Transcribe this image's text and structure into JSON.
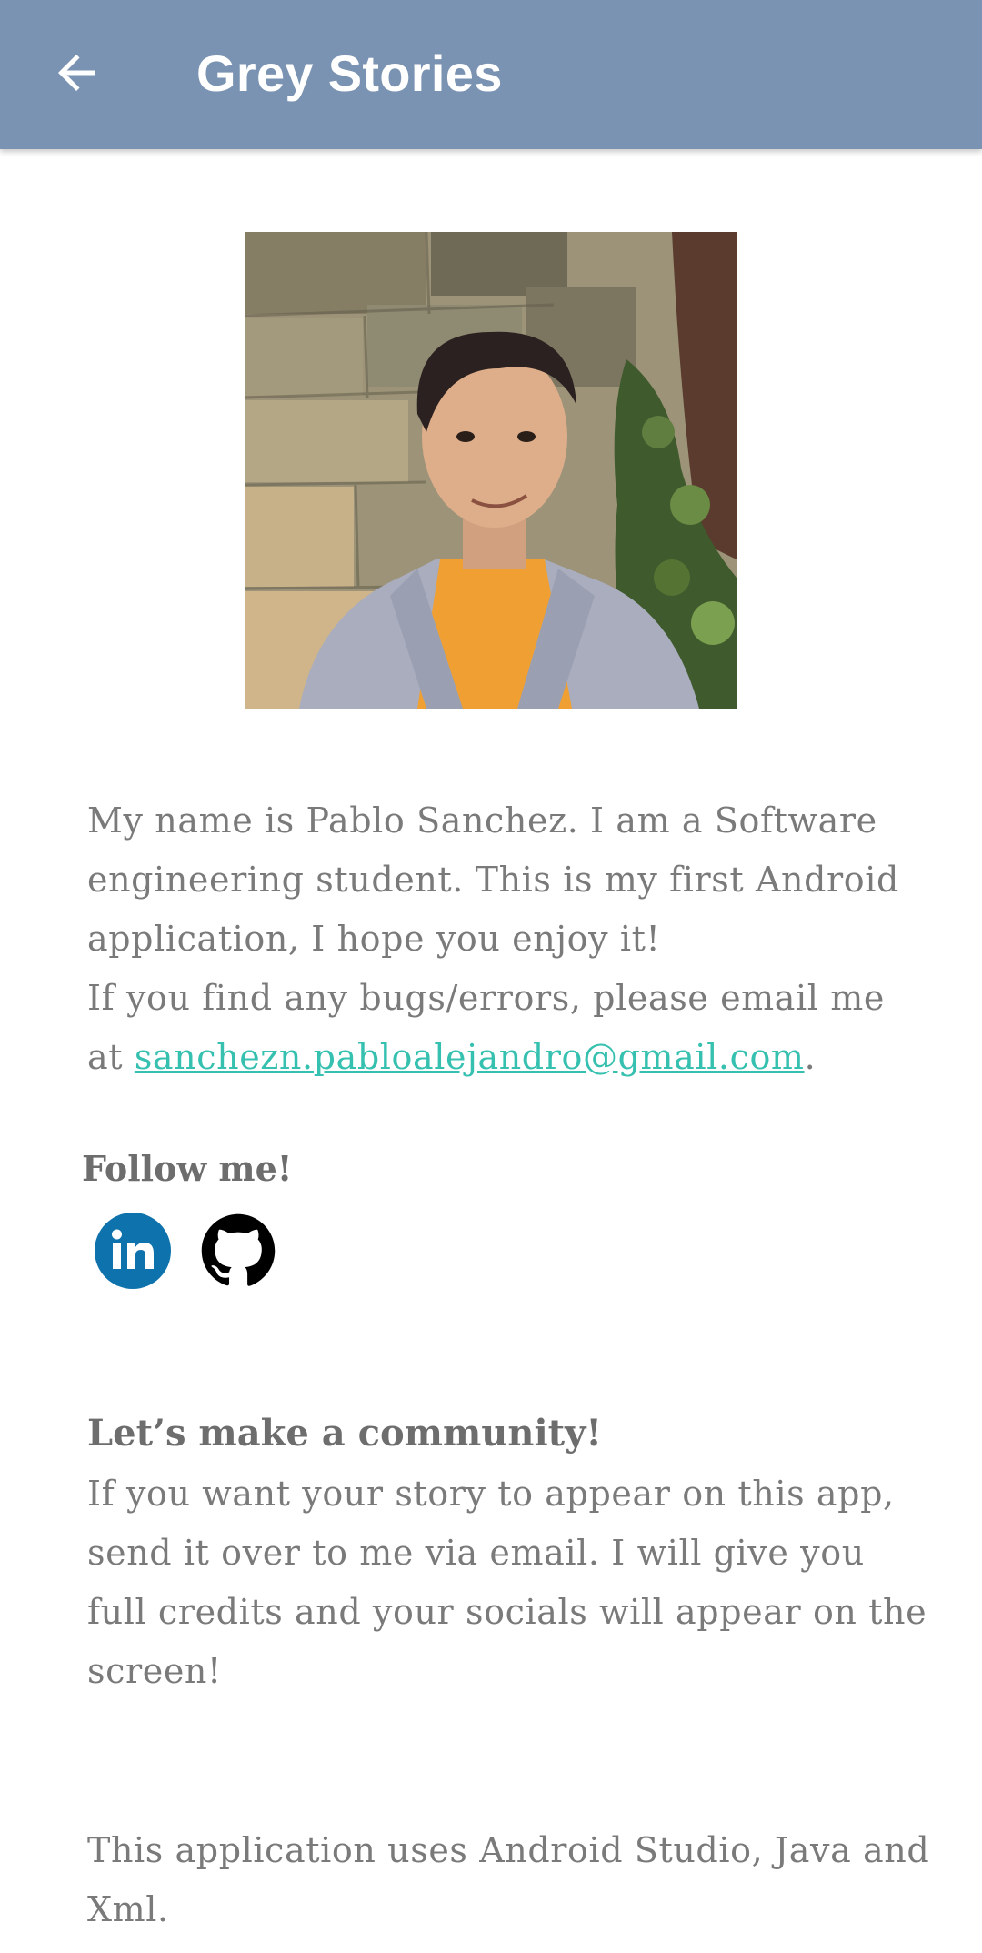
{
  "appbar": {
    "title": "Grey Stories",
    "back_icon": "arrow-left-icon",
    "background": "#7a93b2"
  },
  "profile": {
    "photo_description_icon": "profile-photo"
  },
  "intro": {
    "text_before_email": "My name is Pablo Sanchez. I am a Software engineering student. This is my first Android application, I hope you enjoy it!",
    "bug_text": "If you find any bugs/errors, please email me at ",
    "email": "sanchezn.pabloalejandro@gmail.com",
    "text_after_email": ".",
    "link_color": "#35c0b0"
  },
  "follow": {
    "label": "Follow me!",
    "linkedin_icon": "linkedin-icon",
    "github_icon": "github-icon"
  },
  "community": {
    "title": "Let’s make a community!",
    "body": "If you want your story to appear on this app, send it over to me via email. I will give you full credits and your socials will appear on the screen!"
  },
  "tech": {
    "text": "This application uses Android Studio, Java and Xml."
  }
}
